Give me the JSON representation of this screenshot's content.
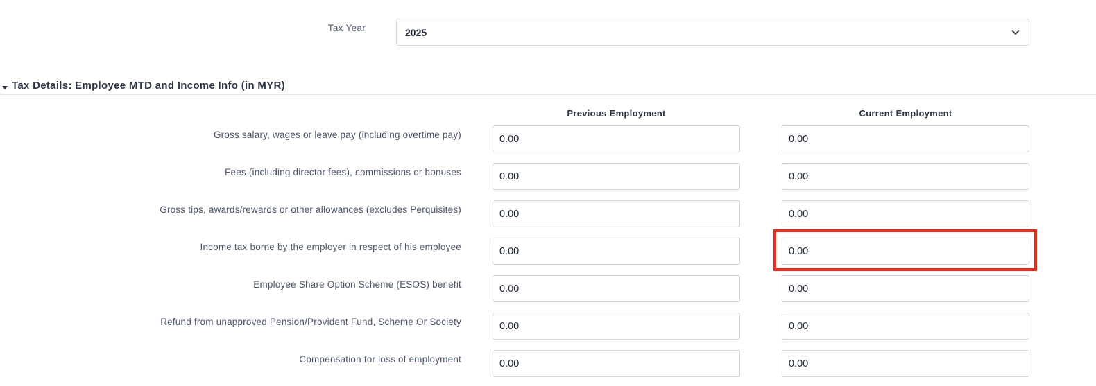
{
  "tax_year": {
    "label": "Tax Year",
    "selected": "2025"
  },
  "section": {
    "title": "Tax Details: Employee MTD and Income Info (in MYR)"
  },
  "columns": {
    "previous": "Previous Employment",
    "current": "Current Employment"
  },
  "rows": [
    {
      "label": "Gross salary, wages or leave pay (including overtime pay)",
      "previous": "0.00",
      "current": "0.00"
    },
    {
      "label": "Fees (including director fees), commissions or bonuses",
      "previous": "0.00",
      "current": "0.00"
    },
    {
      "label": "Gross tips, awards/rewards or other allowances (excludes Perquisites)",
      "previous": "0.00",
      "current": "0.00"
    },
    {
      "label": "Income tax borne by the employer in respect of his employee",
      "previous": "0.00",
      "current": "0.00"
    },
    {
      "label": "Employee Share Option Scheme (ESOS) benefit",
      "previous": "0.00",
      "current": "0.00"
    },
    {
      "label": "Refund from unapproved Pension/Provident Fund, Scheme Or Society",
      "previous": "0.00",
      "current": "0.00"
    },
    {
      "label": "Compensation for loss of employment",
      "previous": "0.00",
      "current": "0.00"
    }
  ],
  "colors": {
    "highlight": "#f02d1c",
    "text": "#4a5568",
    "border": "#cfd2d7"
  }
}
